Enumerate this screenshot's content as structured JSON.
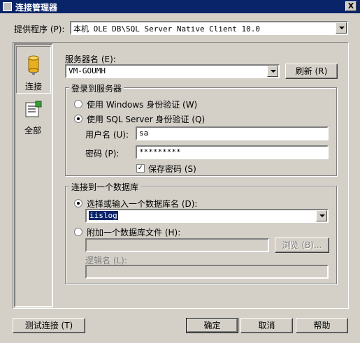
{
  "window": {
    "title": "连接管理器",
    "close_label": "X"
  },
  "provider": {
    "label": "提供程序 (P):",
    "value": "本机 OLE DB\\SQL Server Native Client 10.0"
  },
  "sidebar": {
    "items": [
      {
        "label": "连接",
        "icon": "database-cylinder-icon"
      },
      {
        "label": "全部",
        "icon": "properties-list-icon"
      }
    ]
  },
  "server": {
    "label": "服务器名 (E):",
    "value": "VM-GOUMH",
    "refresh_label": "刷新 (R)"
  },
  "login": {
    "title": "登录到服务器",
    "windows_auth_label": "使用 Windows 身份验证 (W)",
    "sql_auth_label": "使用 SQL Server 身份验证 (Q)",
    "selected": "sql",
    "username_label": "用户名 (U):",
    "username_value": "sa",
    "password_label": "密码 (P):",
    "password_value": "*********",
    "save_password_label": "保存密码 (S)",
    "save_password_checked": true
  },
  "database": {
    "title": "连接到一个数据库",
    "select_db_label": "选择或输入一个数据库名 (D):",
    "select_db_value": "iislog",
    "attach_file_label": "附加一个数据库文件 (H):",
    "attach_file_value": "",
    "browse_label": "浏览 (B)...",
    "logical_name_label": "逻辑名 (L):",
    "logical_name_value": "",
    "selected": "select"
  },
  "footer": {
    "test_label": "测试连接 (T)",
    "ok_label": "确定",
    "cancel_label": "取消",
    "help_label": "帮助"
  }
}
